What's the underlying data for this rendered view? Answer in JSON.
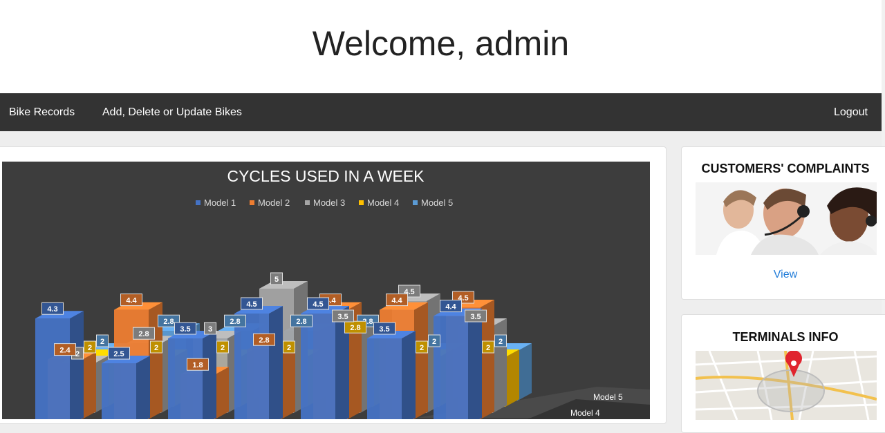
{
  "header": {
    "title": "Welcome, admin"
  },
  "navbar": {
    "links": [
      {
        "label": "Bike Records"
      },
      {
        "label": "Add, Delete or Update Bikes"
      }
    ],
    "logout_label": "Logout"
  },
  "sidebar": {
    "complaints": {
      "title": "CUSTOMERS' COMPLAINTS",
      "link_label": "View"
    },
    "terminals": {
      "title": "TERMINALS INFO"
    }
  },
  "colors": {
    "model1": "#4472c4",
    "model2": "#ed7d31",
    "model3": "#a5a5a5",
    "model4": "#ffc000",
    "model5": "#5b9bd5",
    "chart_bg": "#3d3d3d",
    "nav_bg": "#333333",
    "link": "#1f7bd8"
  },
  "chart_data": {
    "type": "bar",
    "title": "CYCLES USED IN A WEEK",
    "legend_position": "top",
    "series": [
      {
        "name": "Model 1",
        "values": [
          4.3,
          2.5,
          3.5,
          4.5,
          4.5,
          3.5,
          4.4
        ]
      },
      {
        "name": "Model 2",
        "values": [
          2.4,
          4.4,
          1.8,
          2.8,
          4.4,
          4.4,
          4.5
        ]
      },
      {
        "name": "Model 3",
        "values": [
          2,
          2.8,
          3,
          5,
          3.5,
          4.5,
          3.5
        ]
      },
      {
        "name": "Model 4",
        "values": [
          2,
          2,
          2,
          2,
          2.8,
          2,
          2
        ]
      },
      {
        "name": "Model 5",
        "values": [
          2,
          2.8,
          2.8,
          2.8,
          2.8,
          2,
          2
        ]
      }
    ],
    "axis_labels": [
      "Model 5",
      "Model 4"
    ]
  }
}
